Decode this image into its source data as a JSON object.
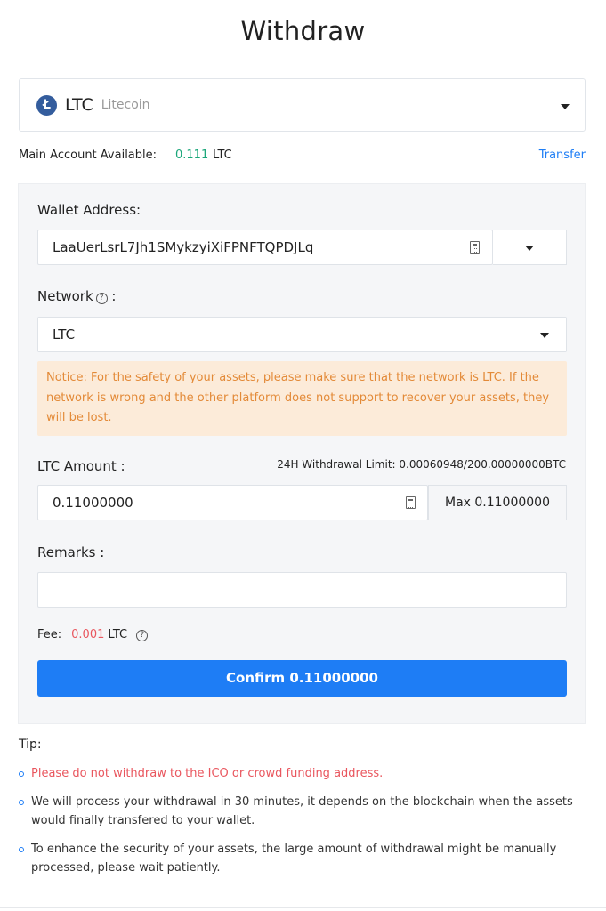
{
  "page": {
    "title": "Withdraw"
  },
  "coin": {
    "icon": "litecoin-icon",
    "symbol": "LTC",
    "name": "Litecoin"
  },
  "account": {
    "label": "Main Account Available:",
    "amount": "0.111",
    "unit": "LTC",
    "transfer_label": "Transfer"
  },
  "form": {
    "wallet_label": "Wallet Address:",
    "wallet_value": "LaaUerLsrL7Jh1SMykzyiXiFPNFTQPDJLq",
    "network_label": "Network",
    "network_suffix": ":",
    "network_value": "LTC",
    "notice": "Notice: For the safety of your assets, please make sure that the network is LTC. If the network is wrong and the other platform does not support to recover your assets, they will be lost.",
    "amount_label": "LTC Amount :",
    "limit_text": "24H Withdrawal Limit: 0.00060948/200.00000000BTC",
    "amount_value": "0.11000000",
    "max_label": "Max 0.11000000",
    "remarks_label": "Remarks :",
    "remarks_value": "",
    "fee_label": "Fee:",
    "fee_value": "0.001",
    "fee_unit": "LTC",
    "confirm_label": "Confirm 0.11000000"
  },
  "tips": {
    "title": "Tip:",
    "items": [
      "Please do not withdraw to the ICO or crowd funding address.",
      "We will process your withdrawal in 30 minutes, it depends on the blockchain when the assets would finally transfered to your wallet.",
      "To enhance the security of your assets, the large amount of withdrawal might be manually processed, please wait patiently."
    ]
  },
  "colors": {
    "accent": "#1e7df5",
    "available": "#1aa679",
    "fee": "#e9565e",
    "notice_bg": "#fcebd9",
    "notice_text": "#e38a38",
    "coin_icon": "#345d9d"
  }
}
